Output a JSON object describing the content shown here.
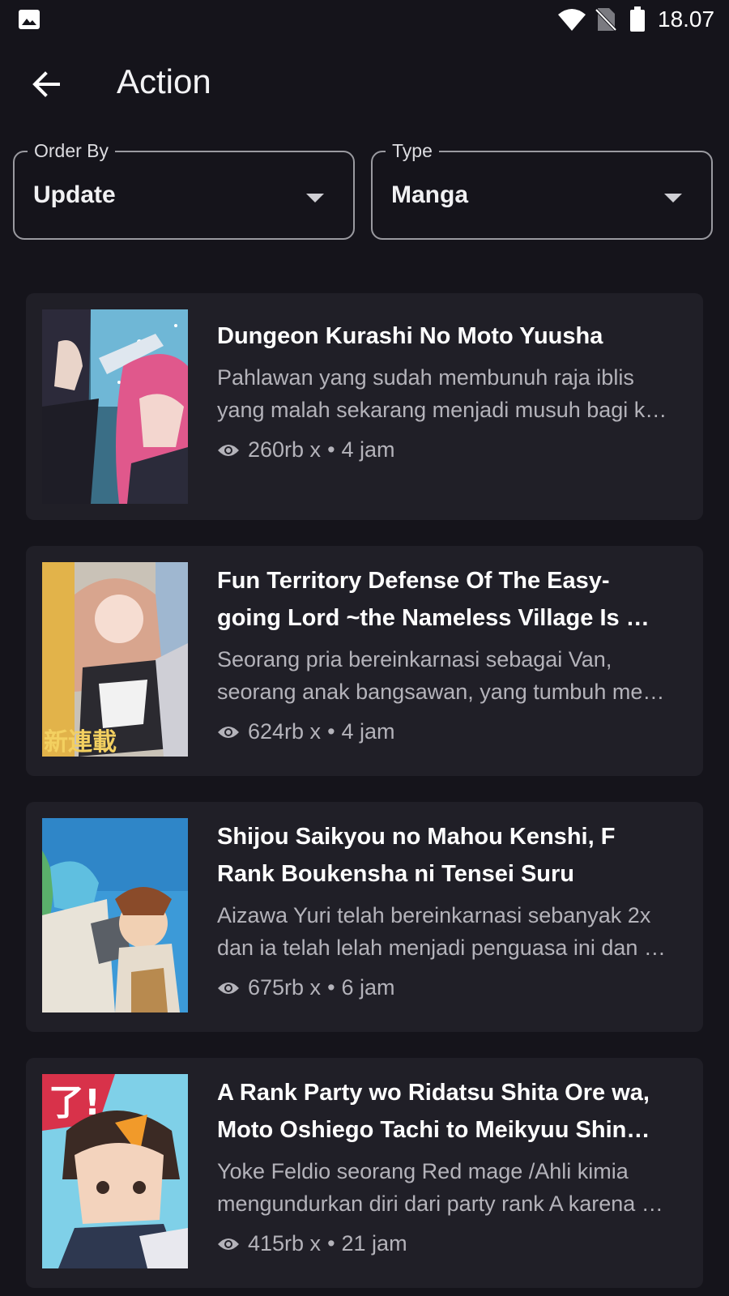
{
  "status_bar": {
    "time": "18.07",
    "icons": [
      "gallery-icon",
      "wifi-icon",
      "no-sim-icon",
      "battery-icon"
    ]
  },
  "app_bar": {
    "title": "Action",
    "back_icon": "arrow-left-icon"
  },
  "filters": {
    "order_by": {
      "label": "Order By",
      "value": "Update"
    },
    "type": {
      "label": "Type",
      "value": "Manga"
    }
  },
  "colors": {
    "background": "#15141b",
    "card": "#201f27",
    "secondary_text": "#b4b3ba"
  },
  "items": [
    {
      "title_lines": [
        "Dungeon Kurashi No Moto Yuusha"
      ],
      "desc_lines": [
        "Pahlawan yang sudah membunuh raja iblis",
        "yang malah sekarang menjadi musuh bagi k…"
      ],
      "views": "260rb x",
      "time": "4 jam"
    },
    {
      "title_lines": [
        "Fun Territory Defense Of The Easy-",
        "going Lord ~the Nameless Village Is …"
      ],
      "desc_lines": [
        "Seorang pria bereinkarnasi sebagai Van,",
        "seorang anak bangsawan, yang tumbuh me…"
      ],
      "views": "624rb x",
      "time": "4 jam"
    },
    {
      "title_lines": [
        "Shijou Saikyou no Mahou Kenshi, F",
        "Rank Boukensha ni Tensei Suru"
      ],
      "desc_lines": [
        "Aizawa Yuri telah bereinkarnasi sebanyak 2x",
        "dan ia telah lelah menjadi penguasa ini dan …"
      ],
      "views": "675rb x",
      "time": "6 jam"
    },
    {
      "title_lines": [
        "A Rank Party wo Ridatsu Shita Ore wa,",
        "Moto Oshiego Tachi to Meikyuu Shin…"
      ],
      "desc_lines": [
        "Yoke Feldio seorang Red mage /Ahli kimia",
        "mengundurkan diri dari party rank A karena …"
      ],
      "views": "415rb x",
      "time": "21 jam"
    }
  ],
  "thumb_chars": {
    "2": "新連載",
    "4": "了!"
  }
}
